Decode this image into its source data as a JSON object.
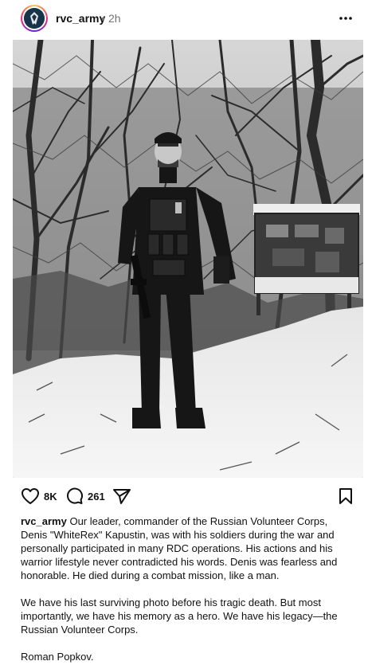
{
  "post": {
    "username": "rvc_army",
    "separator": "•",
    "time": "2h"
  },
  "icons": {
    "avatar": "rvc-logo-avatar",
    "more": "more-horizontal-icon",
    "like": "heart-icon",
    "comment": "comment-bubble-icon",
    "share": "send-icon",
    "save": "bookmark-icon"
  },
  "actions": {
    "likes": "8K",
    "comments": "261"
  },
  "caption": {
    "username": "rvc_army",
    "paragraph1": "Our leader, commander of the Russian Volunteer Corps, Denis \"WhiteRex\" Kapustin, was with his soldiers during the war and personally participated in many RDC operations. His actions and his warrior lifestyle never contradicted his words. Denis was fearless and honorable. He died during a combat mission, like a man.",
    "paragraph2": "We have his last surviving photo before his tragic death. But most importantly, we have his memory as a hero. We have his legacy—the Russian Volunteer Corps.",
    "paragraph3": "Roman Popkov."
  }
}
